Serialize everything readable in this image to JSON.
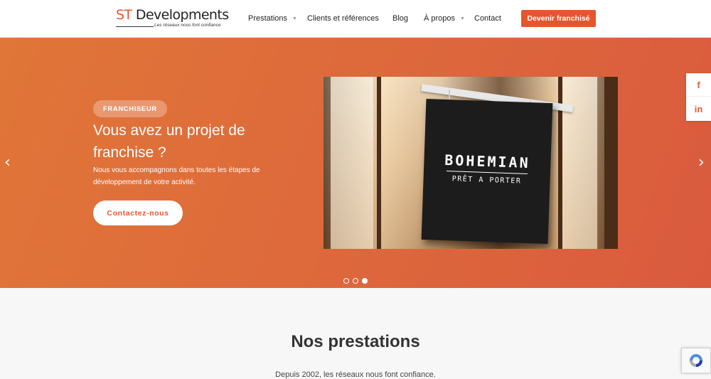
{
  "header": {
    "logo": {
      "brand_prefix": "ST",
      "brand_name": "Developments",
      "tagline": "Les réseaux nous font confiance"
    },
    "nav": [
      {
        "label": "Prestations",
        "has_dropdown": true
      },
      {
        "label": "Clients et références",
        "has_dropdown": false
      },
      {
        "label": "Blog",
        "has_dropdown": false
      },
      {
        "label": "À propos",
        "has_dropdown": true
      },
      {
        "label": "Contact",
        "has_dropdown": false
      }
    ],
    "cta_label": "Devenir franchisé"
  },
  "hero": {
    "badge": "FRANCHISEUR",
    "title": "Vous avez un projet de franchise ?",
    "description": "Nous vous accompagnons dans toutes les étapes de développement de votre activité.",
    "button_label": "Contactez-nous",
    "image": {
      "sign_brand": "BOHEMIAN",
      "sign_sub": "PRÊT A PORTER"
    },
    "slides_total": 3,
    "active_slide": 3,
    "prev_icon": "chevron-left-icon",
    "next_icon": "chevron-right-icon"
  },
  "social": [
    {
      "name": "facebook-icon",
      "glyph": "f"
    },
    {
      "name": "linkedin-icon",
      "glyph": "in"
    }
  ],
  "services": {
    "title": "Nos prestations",
    "subtitle": "Depuis 2002, les réseaux nous font confiance."
  },
  "colors": {
    "accent": "#e4572e",
    "hero_gradient_start": "#e07638",
    "hero_gradient_end": "#da5a3e",
    "section_bg": "#f7f7f7"
  }
}
